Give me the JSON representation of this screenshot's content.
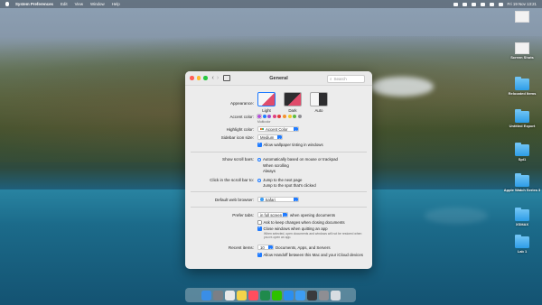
{
  "menubar": {
    "app": "System Preferences",
    "items": [
      "Edit",
      "View",
      "Window",
      "Help"
    ],
    "datetime": "Fri 19 Nov 13:21"
  },
  "desktop": [
    {
      "label": "",
      "kind": "screenshot"
    },
    {
      "label": "Screen Shots",
      "kind": "screenshot"
    },
    {
      "label": "Relocated Items",
      "kind": "folder"
    },
    {
      "label": "Untitled Export",
      "kind": "folder"
    },
    {
      "label": "Spi1",
      "kind": "folder"
    },
    {
      "label": "Apple Watch Series 3",
      "kind": "folder"
    },
    {
      "label": "XSMAX",
      "kind": "folder"
    },
    {
      "label": "Lab 1",
      "kind": "folder"
    }
  ],
  "window": {
    "title": "General",
    "search_placeholder": "Search",
    "appearance": {
      "label": "Appearance:",
      "options": [
        "Light",
        "Dark",
        "Auto"
      ],
      "selected": "Light"
    },
    "accent": {
      "label": "Accent color:",
      "colors": [
        "#b34fd9",
        "#1f7bff",
        "#a04fd0",
        "#e0407d",
        "#e33b3b",
        "#f4912d",
        "#f3c92b",
        "#5dbb3d",
        "#8e8e93"
      ],
      "caption": "Multicolor"
    },
    "highlight": {
      "label": "Highlight color:",
      "value": "Accent Color"
    },
    "sidebar_icon": {
      "label": "Sidebar icon size:",
      "value": "Medium"
    },
    "wallpaper_tinting": "Allow wallpaper tinting in windows",
    "scroll_bars": {
      "label": "Show scroll bars:",
      "options": [
        "Automatically based on mouse or trackpad",
        "When scrolling",
        "Always"
      ]
    },
    "scroll_click": {
      "label": "Click in the scroll bar to:",
      "options": [
        "Jump to the next page",
        "Jump to the spot that's clicked"
      ]
    },
    "browser": {
      "label": "Default web browser:",
      "value": "Safari"
    },
    "prefer_tabs": {
      "label": "Prefer tabs:",
      "value": "in full screen",
      "suffix": "when opening documents"
    },
    "ask_keep": "Ask to keep changes when closing documents",
    "close_windows": "Close windows when quitting an app",
    "close_windows_note": "When selected, open documents and windows will not be restored when you re-open an app.",
    "recent": {
      "label": "Recent items:",
      "value": "10",
      "suffix": "Documents, Apps, and Servers"
    },
    "handoff": "Allow Handoff between this Mac and your iCloud devices"
  },
  "dock": {
    "apps": [
      {
        "name": "finder-icon",
        "color": "#3a8ee6",
        "glyph": ""
      },
      {
        "name": "launchpad-icon",
        "color": "#7b7f86",
        "glyph": ""
      },
      {
        "name": "chrome-icon",
        "color": "#e8e8e8",
        "glyph": ""
      },
      {
        "name": "notes-icon",
        "color": "#f4d34a",
        "glyph": ""
      },
      {
        "name": "music-icon",
        "color": "#ff4d5e",
        "glyph": ""
      },
      {
        "name": "excel-icon",
        "color": "#1f8a4c",
        "glyph": ""
      },
      {
        "name": "wechat-icon",
        "color": "#2dc100",
        "glyph": ""
      },
      {
        "name": "appstore-icon",
        "color": "#2b8ef0",
        "glyph": ""
      },
      {
        "name": "safari-icon",
        "color": "#3d9df4",
        "glyph": ""
      },
      {
        "name": "screen-icon",
        "color": "#3a3a3c",
        "glyph": ""
      },
      {
        "name": "preferences-icon",
        "color": "#8e8e93",
        "glyph": ""
      },
      {
        "name": "trash-icon",
        "color": "#d8dde2",
        "glyph": ""
      }
    ]
  }
}
